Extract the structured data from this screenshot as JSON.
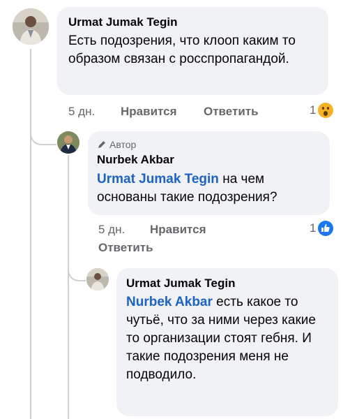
{
  "comments": [
    {
      "author": "Urmat Jumak Tegin",
      "text": "Есть подозрения, что клооп каким то образом связан с росспропагандой.",
      "time": "5 дн.",
      "like_label": "Нравится",
      "reply_label": "Ответить",
      "reaction_count": "1",
      "reaction_icon": "wow-emoji-icon"
    },
    {
      "author_badge": "Автор",
      "author": "Nurbek Akbar",
      "mention": "Urmat Jumak Tegin",
      "text": " на чем основаны такие подозрения?",
      "time": "5 дн.",
      "like_label": "Нравится",
      "reply_label": "Ответить",
      "reaction_count": "1",
      "reaction_icon": "like-thumb-icon"
    },
    {
      "author": "Urmat Jumak Tegin",
      "mention": "Nurbek Akbar",
      "text": " есть какое то чутьё, что за ними через какие то организации стоят гебня. И такие подозрения меня не подводило."
    }
  ],
  "colors": {
    "bubble": "#f0f2f5",
    "mention": "#1b62c9",
    "meta": "#65676b",
    "like_blue": "#1877f2",
    "wow_yellow": "#f7b125"
  }
}
